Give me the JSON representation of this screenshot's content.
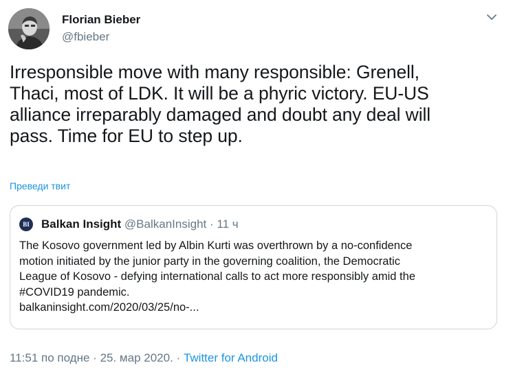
{
  "author": {
    "name": "Florian Bieber",
    "handle": "@fbieber",
    "avatar_icon": "profile-photo"
  },
  "menu": {
    "icon": "chevron-down-icon"
  },
  "tweet": {
    "lines": [
      "Irresponsible move with many responsible: Grenell,",
      "Thaci, most of LDK. It will be a phyric victory. EU-US",
      "alliance irreparably damaged and doubt any deal will",
      "pass. Time for EU to step up."
    ],
    "translate_label": "Преведи твит"
  },
  "quote": {
    "logo_text": "BI",
    "name": "Balkan Insight",
    "handle": "@BalkanInsight",
    "separator": "·",
    "time": "11 ч",
    "lines": [
      "The Kosovo government led by Albin Kurti was overthrown by a no-confidence",
      "motion initiated by the junior party in the governing coalition, the Democratic",
      "League of Kosovo - defying international calls to act more responsibly amid the",
      "#COVID19 pandemic."
    ],
    "link": "balkaninsight.com/2020/03/25/no-..."
  },
  "meta": {
    "time": "11:51 по подне",
    "separator": "·",
    "date": "25. мар 2020.",
    "source": "Twitter for Android"
  },
  "colors": {
    "text": "#14171a",
    "secondary": "#657786",
    "link": "#1b95e0",
    "border": "#ccd6dd",
    "logo_bg": "#1f2f57"
  }
}
